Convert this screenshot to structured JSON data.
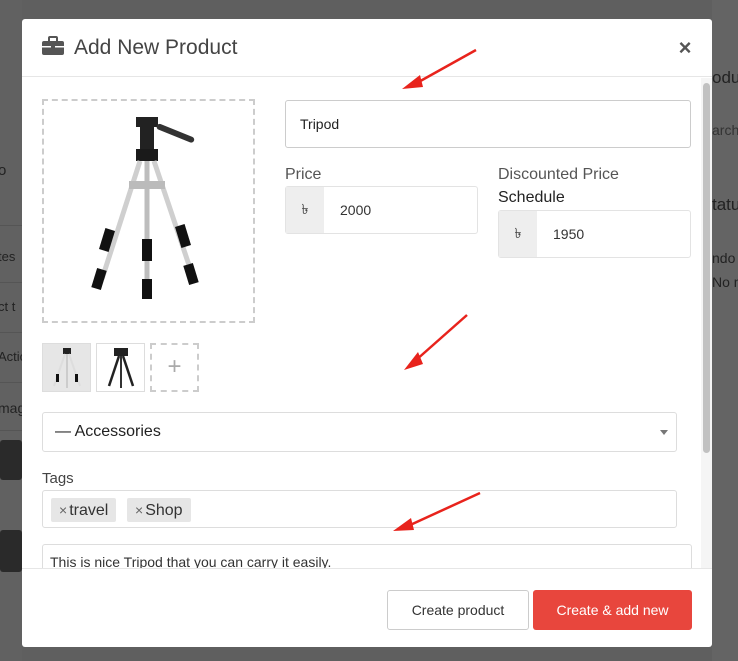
{
  "background": {
    "right_texts": [
      "odu",
      "arch",
      "tatu",
      "ndo",
      "No m"
    ],
    "left_texts": [
      "o",
      "tes",
      "ct t",
      "Actio",
      "mag"
    ]
  },
  "modal": {
    "title": "Add New Product",
    "header_icon": "briefcase-icon",
    "close_label": "×",
    "product_name": "Tripod",
    "price": {
      "label": "Price",
      "currency": "৳",
      "value": "2000"
    },
    "discounted_price": {
      "label": "Discounted Price",
      "schedule_label": "Schedule",
      "currency": "৳",
      "value": "1950"
    },
    "thumb_add": "+",
    "category": "— Accessories",
    "tags_label": "Tags",
    "tags": [
      "travel",
      "Shop"
    ],
    "tag_remove": "×",
    "description": "This is nice Tripod that you can carry it easily.",
    "footer": {
      "create_label": "Create product",
      "create_add_label": "Create & add new"
    }
  },
  "colors": {
    "primary_button": "#e8463d",
    "annotation_arrow": "#e8231c"
  }
}
